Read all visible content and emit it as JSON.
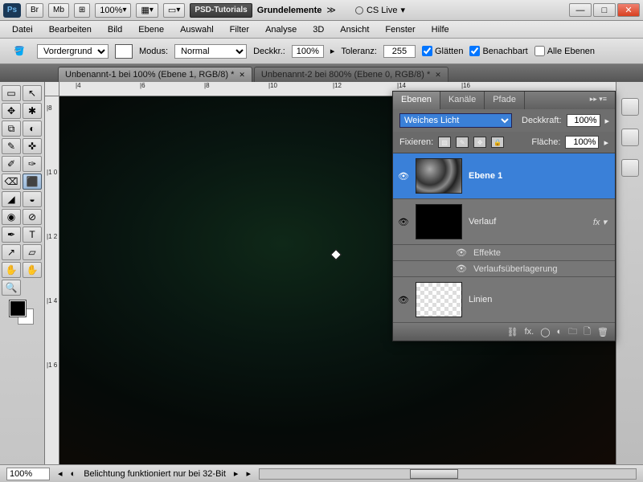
{
  "sysbar": {
    "br": "Br",
    "mb": "Mb",
    "film": "⊞",
    "zoom": "100%",
    "view": "▦",
    "screen": "▭",
    "tutorials": "PSD-Tutorials",
    "workspace": "Grundelemente",
    "chev": "≫",
    "cslive": "CS Live"
  },
  "menu": [
    "Datei",
    "Bearbeiten",
    "Bild",
    "Ebene",
    "Auswahl",
    "Filter",
    "Analyse",
    "3D",
    "Ansicht",
    "Fenster",
    "Hilfe"
  ],
  "optbar": {
    "fill_label": "Vordergrund",
    "mode_label": "Modus:",
    "mode_value": "Normal",
    "opacity_label": "Deckkr.:",
    "opacity_value": "100%",
    "tol_label": "Toleranz:",
    "tol_value": "255",
    "aa_label": "Glätten",
    "contig_label": "Benachbart",
    "all_label": "Alle Ebenen"
  },
  "doctabs": [
    {
      "title": "Unbenannt-1 bei 100% (Ebene 1, RGB/8) *",
      "active": true
    },
    {
      "title": "Unbenannt-2 bei 800% (Ebene 0, RGB/8) *",
      "active": false
    }
  ],
  "tools": [
    [
      "▭",
      "↖"
    ],
    [
      "✥",
      "✱"
    ],
    [
      "⧉",
      "◐"
    ],
    [
      "✎",
      "✜"
    ],
    [
      "✐",
      "✑"
    ],
    [
      "⌫",
      "⬛"
    ],
    [
      "◢",
      "◒"
    ],
    [
      "◉",
      "⊘"
    ],
    [
      "✒",
      "T"
    ],
    [
      "↗",
      "▱"
    ],
    [
      "✋",
      "✋"
    ],
    [
      "⧂",
      "🔍"
    ]
  ],
  "ruler_h": [
    "|4",
    "|6",
    "|8",
    "|10",
    "|12",
    "|14",
    "|16"
  ],
  "ruler_v": [
    "|8",
    "|1 0",
    "|1 2",
    "|1 4",
    "|1 6"
  ],
  "layerspanel": {
    "tabs": [
      "Ebenen",
      "Kanäle",
      "Pfade"
    ],
    "blend": "Weiches Licht",
    "opacity_label": "Deckkraft:",
    "opacity": "100%",
    "lock_label": "Fixieren:",
    "fill_label": "Fläche:",
    "fill": "100%",
    "layers": [
      {
        "name": "Ebene 1",
        "thumb": "clouds",
        "selected": true
      },
      {
        "name": "Verlauf",
        "thumb": "black",
        "fx": true
      },
      {
        "name": "Linien",
        "thumb": "checker"
      }
    ],
    "fx_label": "Effekte",
    "fx_item": "Verlaufsüberlagerung"
  },
  "status": {
    "zoom": "100%",
    "msg": "Belichtung funktioniert nur bei 32-Bit"
  }
}
